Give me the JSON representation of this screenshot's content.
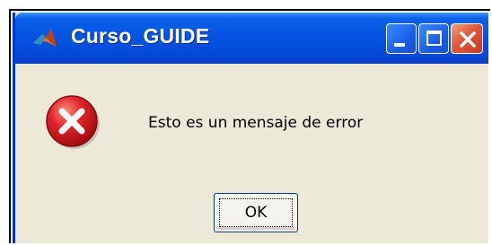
{
  "window": {
    "title": "Curso_GUIDE",
    "buttons": {
      "minimize_icon": "minimize-icon",
      "maximize_icon": "maximize-icon",
      "close_icon": "close-icon"
    }
  },
  "dialog": {
    "icon": "error-icon",
    "message": "Esto es un mensaje de error",
    "ok_label": "OK"
  },
  "colors": {
    "titlebar": "#0553e1",
    "window_bg": "#ece9d8",
    "error_red": "#e3242b",
    "close_button": "#e0573a"
  }
}
